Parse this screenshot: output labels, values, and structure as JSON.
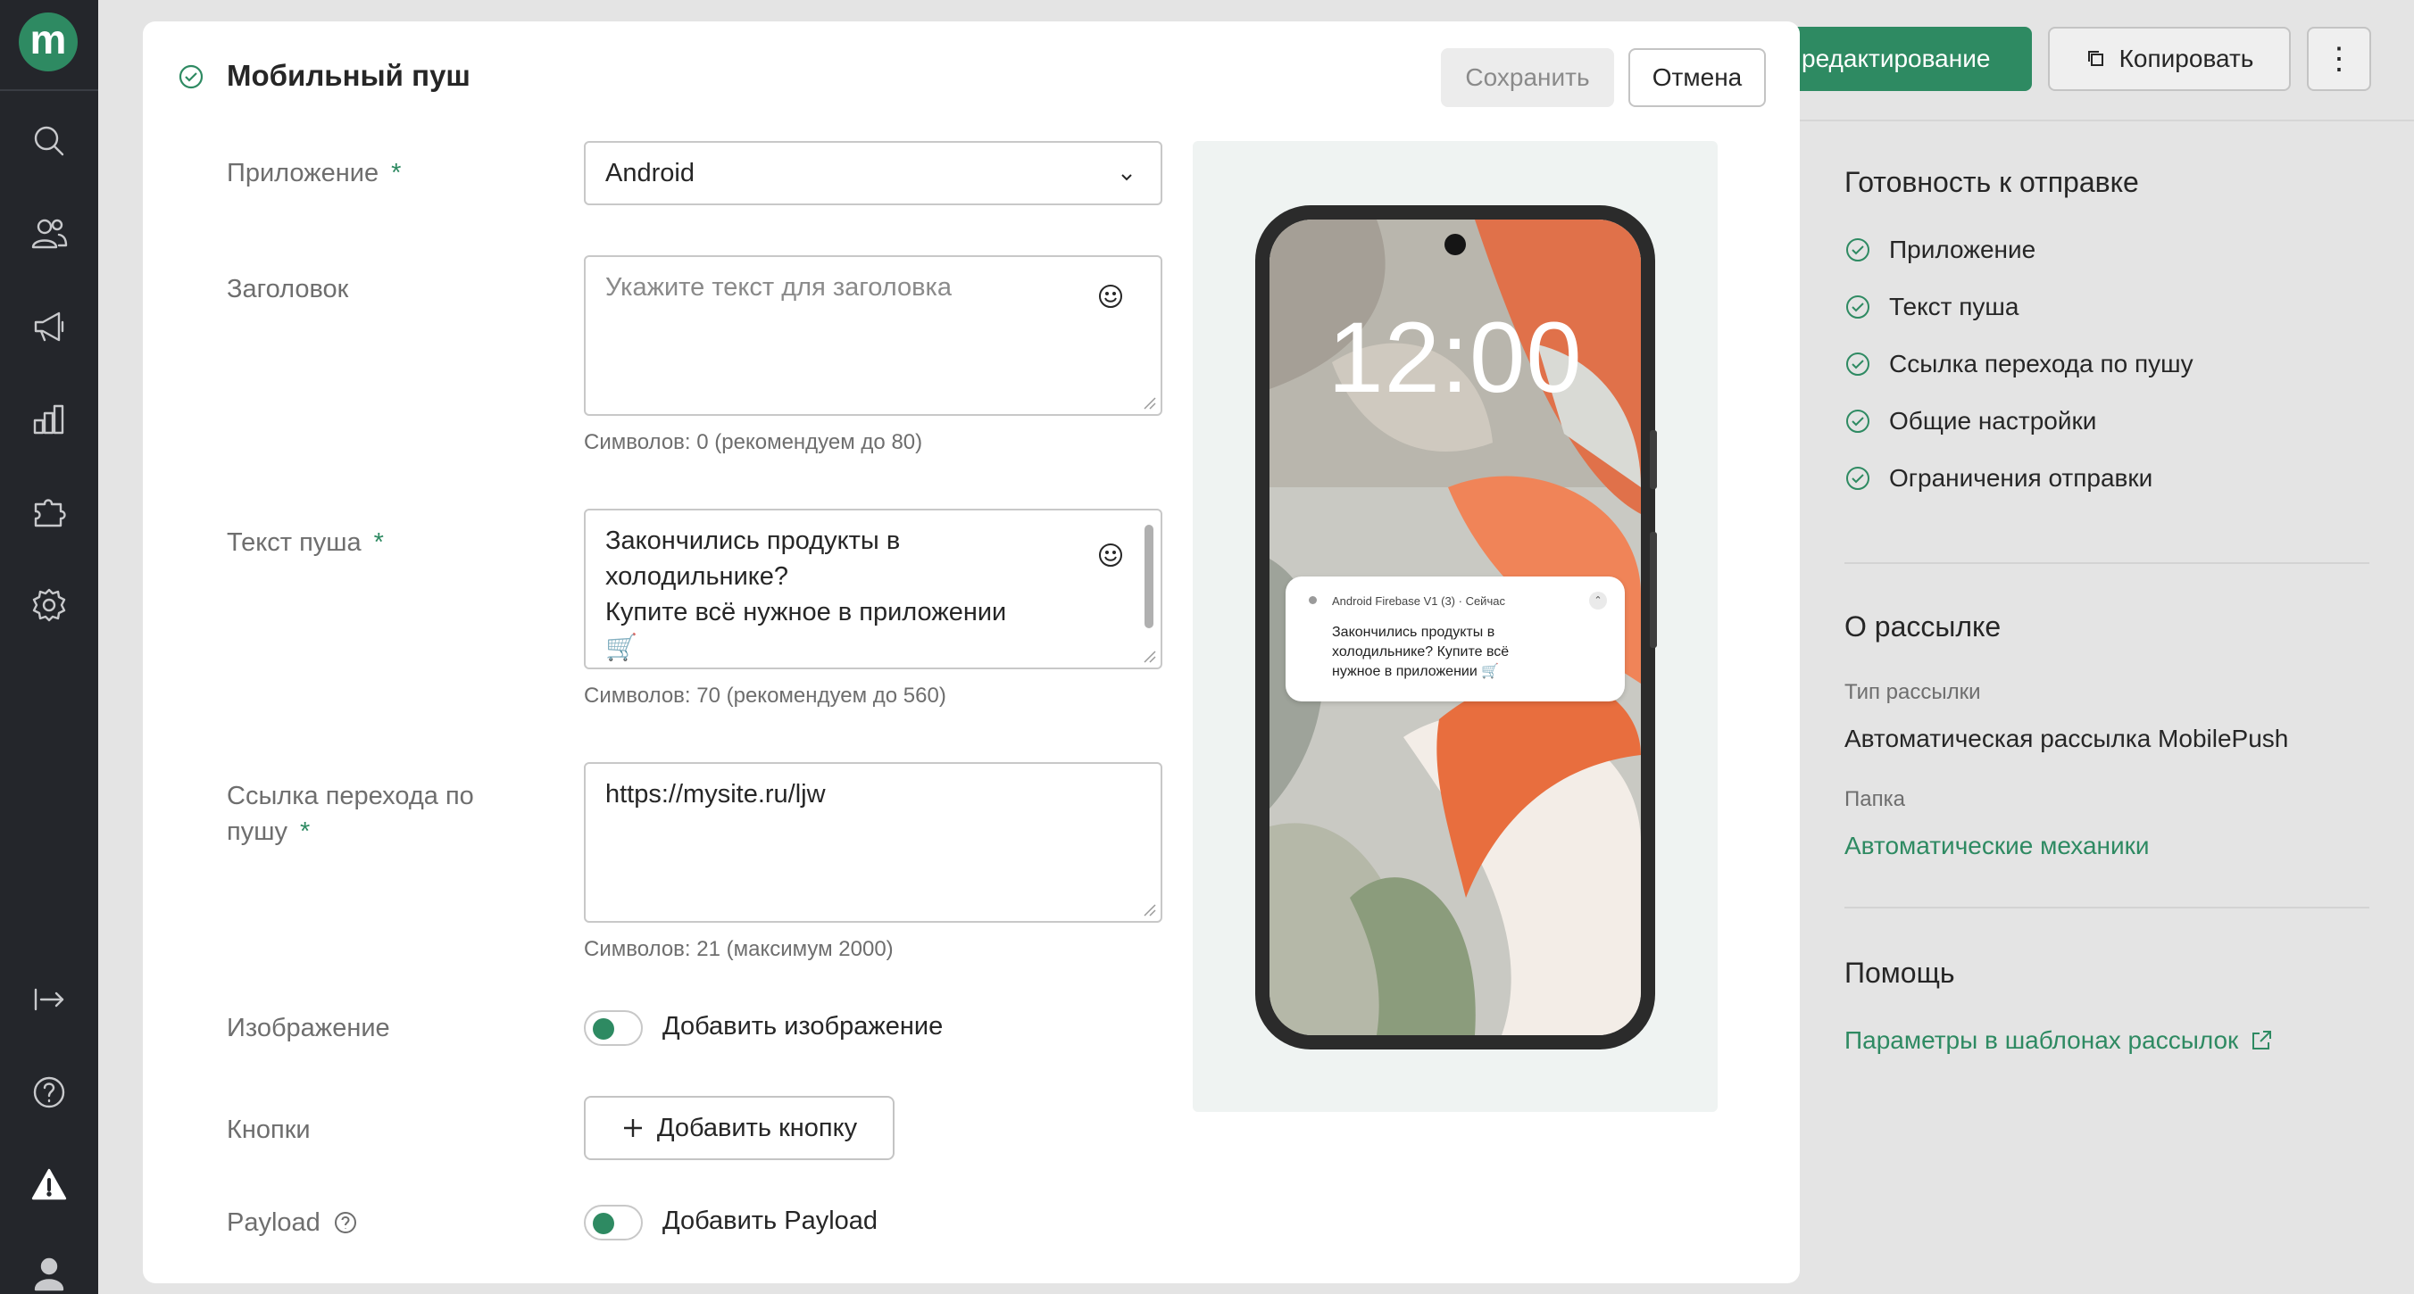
{
  "sidebar": {
    "logo_letter": "m",
    "icons": [
      "search-icon",
      "users-icon",
      "megaphone-icon",
      "analytics-icon",
      "integrations-icon",
      "settings-icon",
      "collapse-icon",
      "help-icon",
      "warning-icon",
      "profile-icon"
    ]
  },
  "toolbar": {
    "edit_label": "редактирование",
    "copy_label": "Копировать",
    "more_label": "⋮"
  },
  "readiness": {
    "title": "Готовность к отправке",
    "items": [
      "Приложение",
      "Текст пуша",
      "Ссылка перехода по пушу",
      "Общие настройки",
      "Ограничения отправки"
    ]
  },
  "about": {
    "title": "О рассылке",
    "type_label": "Тип рассылки",
    "type_value": "Автоматическая рассылка MobilePush",
    "folder_label": "Папка",
    "folder_value": "Автоматические механики"
  },
  "help": {
    "title": "Помощь",
    "link": "Параметры в шаблонах рассылок"
  },
  "modal": {
    "title": "Мобильный пуш",
    "save_label": "Сохранить",
    "cancel_label": "Отмена",
    "required_mark": "*",
    "app": {
      "label": "Приложение",
      "value": "Android"
    },
    "headline": {
      "label": "Заголовок",
      "placeholder": "Укажите текст для заголовка",
      "hint": "Символов: 0 (рекомендуем до 80)"
    },
    "push_text": {
      "label": "Текст пуша",
      "lines": [
        "Закончились продукты в",
        "холодильнике?",
        "Купите всё нужное в приложении",
        "🛒"
      ],
      "hint": "Символов: 70 (рекомендуем до 560)"
    },
    "link": {
      "label_line1": "Ссылка перехода по",
      "label_line2": "пушу",
      "value": "https://mysite.ru/ljw",
      "hint": "Символов: 21 (максимум 2000)"
    },
    "image": {
      "label": "Изображение",
      "toggle_label": "Добавить изображение"
    },
    "buttons": {
      "label": "Кнопки",
      "add_label": "Добавить кнопку"
    },
    "payload": {
      "label": "Payload",
      "toggle_label": "Добавить Payload"
    }
  },
  "preview": {
    "time": "12:00",
    "notification_header": "Android Firebase V1 (3) · Сейчас",
    "notification_lines": [
      "Закончились продукты в",
      "холодильнике? Купите всё",
      "нужное в приложении 🛒"
    ]
  },
  "colors": {
    "accent": "#2e8a62",
    "sidebar": "#24262b",
    "text": "#262626",
    "muted": "#6e6e6e"
  }
}
